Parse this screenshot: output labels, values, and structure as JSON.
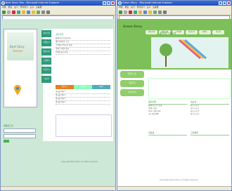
{
  "left_window": {
    "title": "Best Story Site - Microsoft Internet Explorer",
    "menu": [
      "파일",
      "편집",
      "보기",
      "즐겨찾기",
      "도구",
      "도움말"
    ],
    "site": {
      "brand_line1": "Best Story",
      "brand_line2": "Season",
      "nav": [
        "회사소개",
        "사업분야",
        "제품소개",
        "고객센터",
        "커뮤니티",
        "자료실"
      ],
      "notice_title": "공지사항",
      "notice_rows": [
        "홈페이지 리뉴얼 안내",
        "제품 업데이트 소식",
        "고객센터 운영시간 변경",
        "이벤트 당첨자 발표",
        "신제품 출시 안내"
      ],
      "tabs": [
        "최신뉴스",
        "자료실",
        "Q&A"
      ],
      "list_rows": [
        "게시물 목록 1",
        "게시물 목록 2",
        "게시물 목록 3",
        "게시물 목록 4"
      ],
      "login_title": "회원로그인",
      "footer": "Copyright Best Story. All rights reserved."
    }
  },
  "right_window": {
    "title": "Green Story - Microsoft Internet Explorer",
    "menu": [
      "파일",
      "편집",
      "보기",
      "즐겨찾기",
      "도구",
      "도움말"
    ],
    "site": {
      "logo": "Green Story",
      "topnav": [
        "회사소개",
        "제품안내",
        "고객지원",
        "커뮤니티",
        "이벤트",
        "자료실"
      ],
      "hero_text": "즐거운 이야기",
      "side_pills": [
        "회원로그인",
        "회원가입",
        "아이디찾기"
      ],
      "col1_head": "공지사항",
      "col2_head": "새소식",
      "col1_rows": [
        "홈페이지 오픈 안내",
        "이벤트 안내",
        "서비스 점검 안내",
        "신규 회원 혜택"
      ],
      "col2_rows": [
        "최신 소식 1",
        "최신 소식 2",
        "최신 소식 3",
        "최신 소식 4"
      ],
      "col3_head": "자료실",
      "col4_head": "고객센터",
      "footer": "Copyright Green Story. All rights reserved."
    }
  }
}
